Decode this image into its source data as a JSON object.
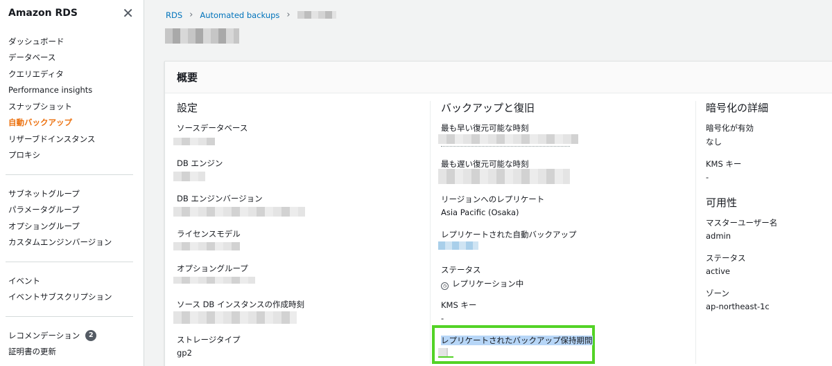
{
  "sidebar": {
    "title": "Amazon RDS",
    "groups": [
      [
        "ダッシュボード",
        "データベース",
        "クエリエディタ",
        "Performance insights",
        "スナップショット",
        "自動バックアップ",
        "リザーブドインスタンス",
        "プロキシ"
      ],
      [
        "サブネットグループ",
        "パラメータグループ",
        "オプショングループ",
        "カスタムエンジンバージョン"
      ],
      [
        "イベント",
        "イベントサブスクリプション"
      ],
      [
        "レコメンデーション",
        "証明書の更新"
      ]
    ],
    "active_item": "自動バックアップ",
    "recommendation_badge": "2"
  },
  "breadcrumb": {
    "root": "RDS",
    "section": "Automated backups"
  },
  "panel": {
    "title": "概要",
    "settings": {
      "heading": "設定",
      "fields": [
        "ソースデータベース",
        "DB エンジン",
        "DB エンジンバージョン",
        "ライセンスモデル",
        "オプショングループ",
        "ソース DB インスタンスの作成時刻",
        "ストレージタイプ"
      ],
      "storage_type": "gp2"
    },
    "backup": {
      "heading": "バックアップと復旧",
      "earliest_label": "最も早い復元可能な時刻",
      "latest_label": "最も遅い復元可能な時刻",
      "region_label": "リージョンへのレプリケート",
      "region_value": "Asia Pacific (Osaka)",
      "replicated_backup_label": "レプリケートされた自動バックアップ",
      "status_label": "ステータス",
      "status_value": "レプリケーション中",
      "kms_label": "KMS キー",
      "kms_value": "-",
      "retention_label": "レプリケートされたバックアップ保持期間"
    },
    "encryption": {
      "heading": "暗号化の詳細",
      "enabled_label": "暗号化が有効",
      "enabled_value": "なし",
      "kms_label": "KMS キー",
      "kms_value": "-"
    },
    "availability": {
      "heading": "可用性",
      "master_user_label": "マスターユーザー名",
      "master_user_value": "admin",
      "status_label": "ステータス",
      "status_value": "active",
      "zone_label": "ゾーン",
      "zone_value": "ap-northeast-1c"
    }
  },
  "colors": {
    "accent": "#ec7211",
    "link": "#0073bb",
    "highlight_border": "#53d326"
  }
}
